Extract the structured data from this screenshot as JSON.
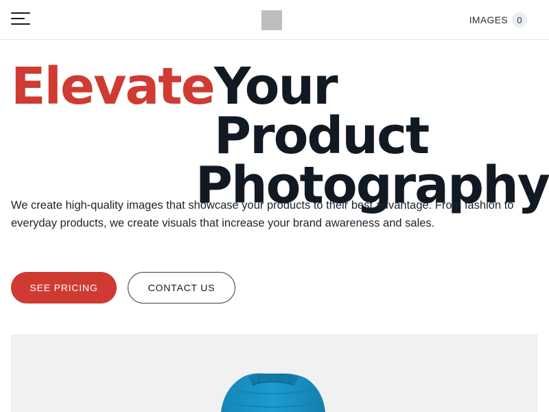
{
  "header": {
    "menu_icon": "hamburger-menu-icon",
    "logo": "site-logo-placeholder",
    "images_label": "IMAGES",
    "images_count": "0"
  },
  "hero": {
    "headline_accent": "Elevate",
    "headline_rest_line1": "Your Product",
    "headline_line2": "Photography",
    "description": "We create high-quality images that showcase your products to their best advantage. From fashion to everyday products, we create visuals that increase your brand awareness and sales.",
    "primary_button": "SEE PRICING",
    "secondary_button": "CONTACT US",
    "product_image": "blue-puffer-jacket-image"
  },
  "colors": {
    "accent": "#cf3b32",
    "text_dark": "#111a22",
    "media_bg": "#f1f1f1",
    "product_blue": "#1a8fc2"
  }
}
